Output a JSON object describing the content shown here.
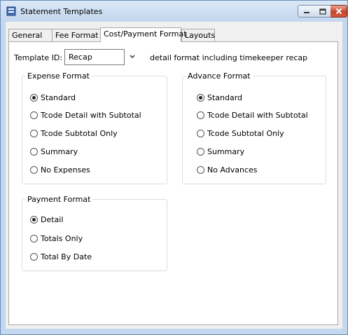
{
  "window": {
    "title": "Statement Templates"
  },
  "tabs": [
    {
      "label": "General",
      "active": false
    },
    {
      "label": "Fee Format",
      "active": false
    },
    {
      "label": "Cost/Payment Format",
      "active": true
    },
    {
      "label": "Layouts",
      "active": false
    }
  ],
  "template": {
    "label": "Template ID:",
    "value": "Recap",
    "description": "detail format including timekeeper recap"
  },
  "expense_format": {
    "title": "Expense Format",
    "options": [
      {
        "label": "Standard",
        "checked": true
      },
      {
        "label": "Tcode Detail with Subtotal",
        "checked": false
      },
      {
        "label": "Tcode Subtotal Only",
        "checked": false
      },
      {
        "label": "Summary",
        "checked": false
      },
      {
        "label": "No Expenses",
        "checked": false
      }
    ]
  },
  "advance_format": {
    "title": "Advance Format",
    "options": [
      {
        "label": "Standard",
        "checked": true
      },
      {
        "label": "Tcode Detail with Subtotal",
        "checked": false
      },
      {
        "label": "Tcode Subtotal Only",
        "checked": false
      },
      {
        "label": "Summary",
        "checked": false
      },
      {
        "label": "No Advances",
        "checked": false
      }
    ]
  },
  "payment_format": {
    "title": "Payment Format",
    "options": [
      {
        "label": "Detail",
        "checked": true
      },
      {
        "label": "Totals Only",
        "checked": false
      },
      {
        "label": "Total By Date",
        "checked": false
      }
    ]
  }
}
